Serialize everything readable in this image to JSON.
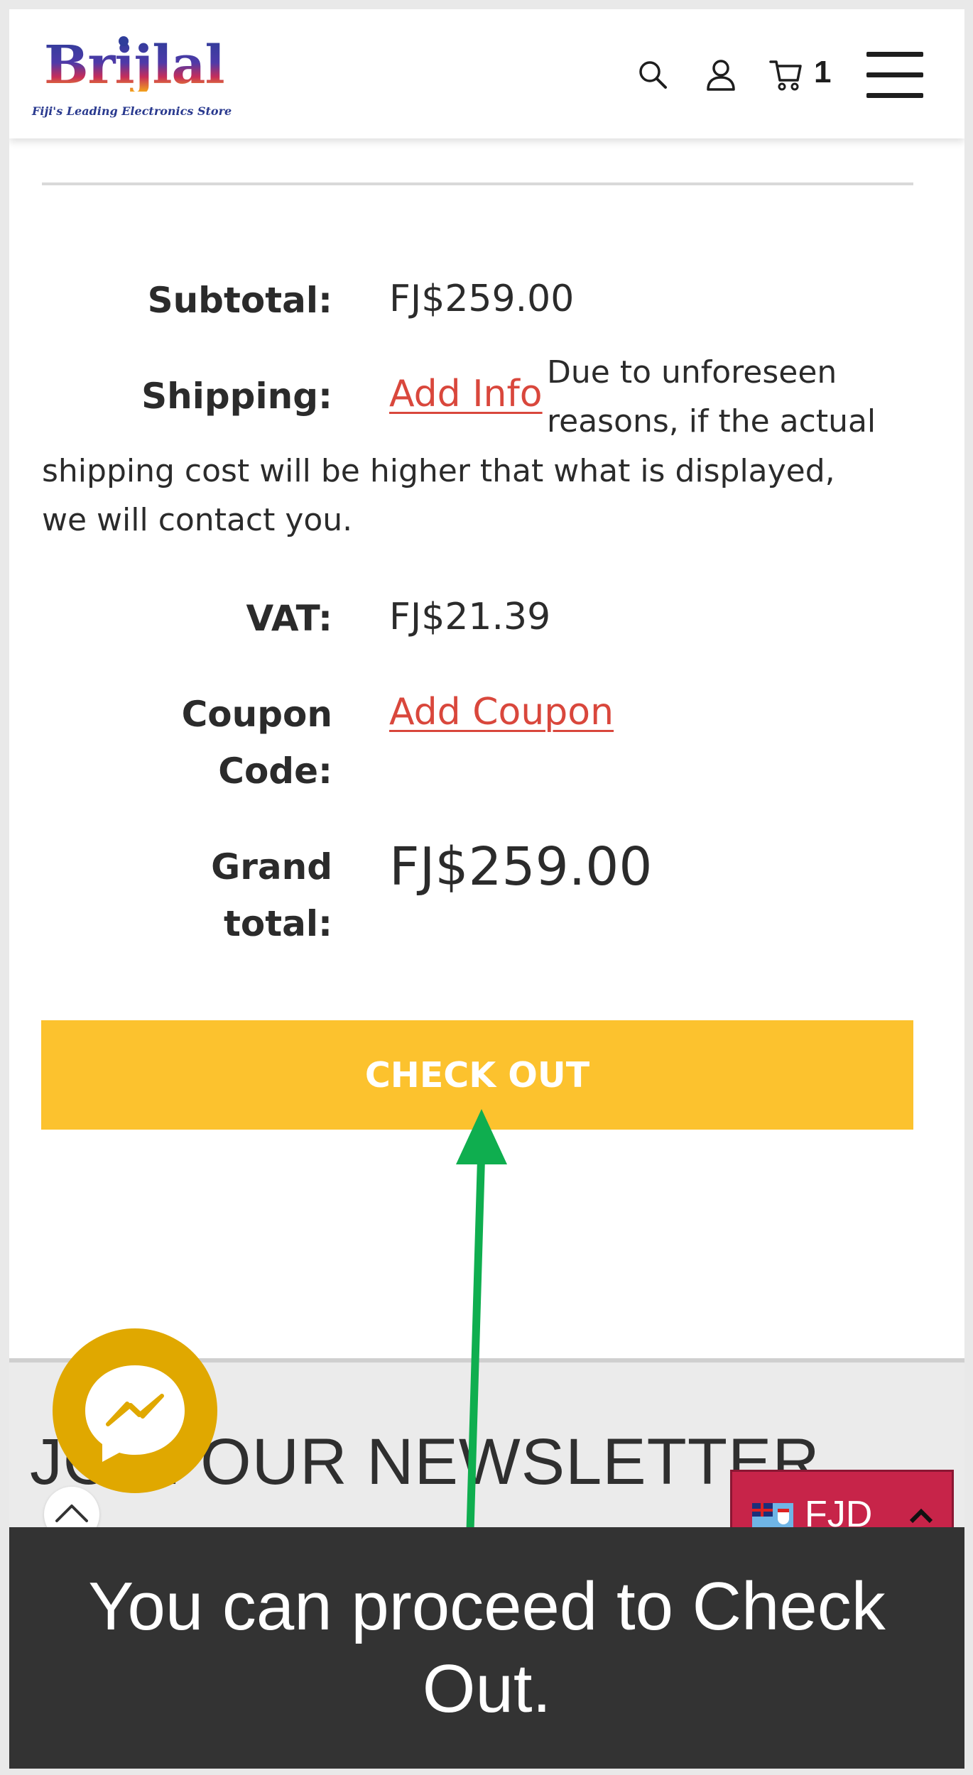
{
  "header": {
    "logo_text": "Brijlal",
    "logo_tagline": "Fiji's Leading Electronics Store",
    "icons": [
      "search-icon",
      "user-icon",
      "cart-icon",
      "menu-icon"
    ],
    "cart_count": "1"
  },
  "totals": {
    "subtotal_label": "Subtotal:",
    "subtotal_value": "FJ$259.00",
    "shipping_label": "Shipping:",
    "shipping_link": "Add Info",
    "shipping_note_line1": "Due to unforeseen",
    "shipping_note_line2": "reasons, if the actual",
    "shipping_note_line3": "shipping cost will be higher that what is displayed,",
    "shipping_note_line4": "we will contact you.",
    "vat_label": "VAT:",
    "vat_value": "FJ$21.39",
    "coupon_label_line1": "Coupon",
    "coupon_label_line2": "Code:",
    "coupon_link": "Add Coupon",
    "grand_total_label_line1": "Grand",
    "grand_total_label_line2": "total:",
    "grand_total_value": "FJ$259.00"
  },
  "checkout_button": "CHECK OUT",
  "newsletter": {
    "title": "JOIN OUR NEWSLETTER"
  },
  "currency": {
    "code": "FJD"
  },
  "overlay": {
    "caption": "You can proceed to Check Out.",
    "arrow_color": "#0fae4f"
  },
  "colors": {
    "accent_yellow": "#fcc22e",
    "link_red": "#d9473c",
    "messenger_gold": "#e0a800",
    "currency_red": "#c72449",
    "caption_bg": "#333333"
  }
}
